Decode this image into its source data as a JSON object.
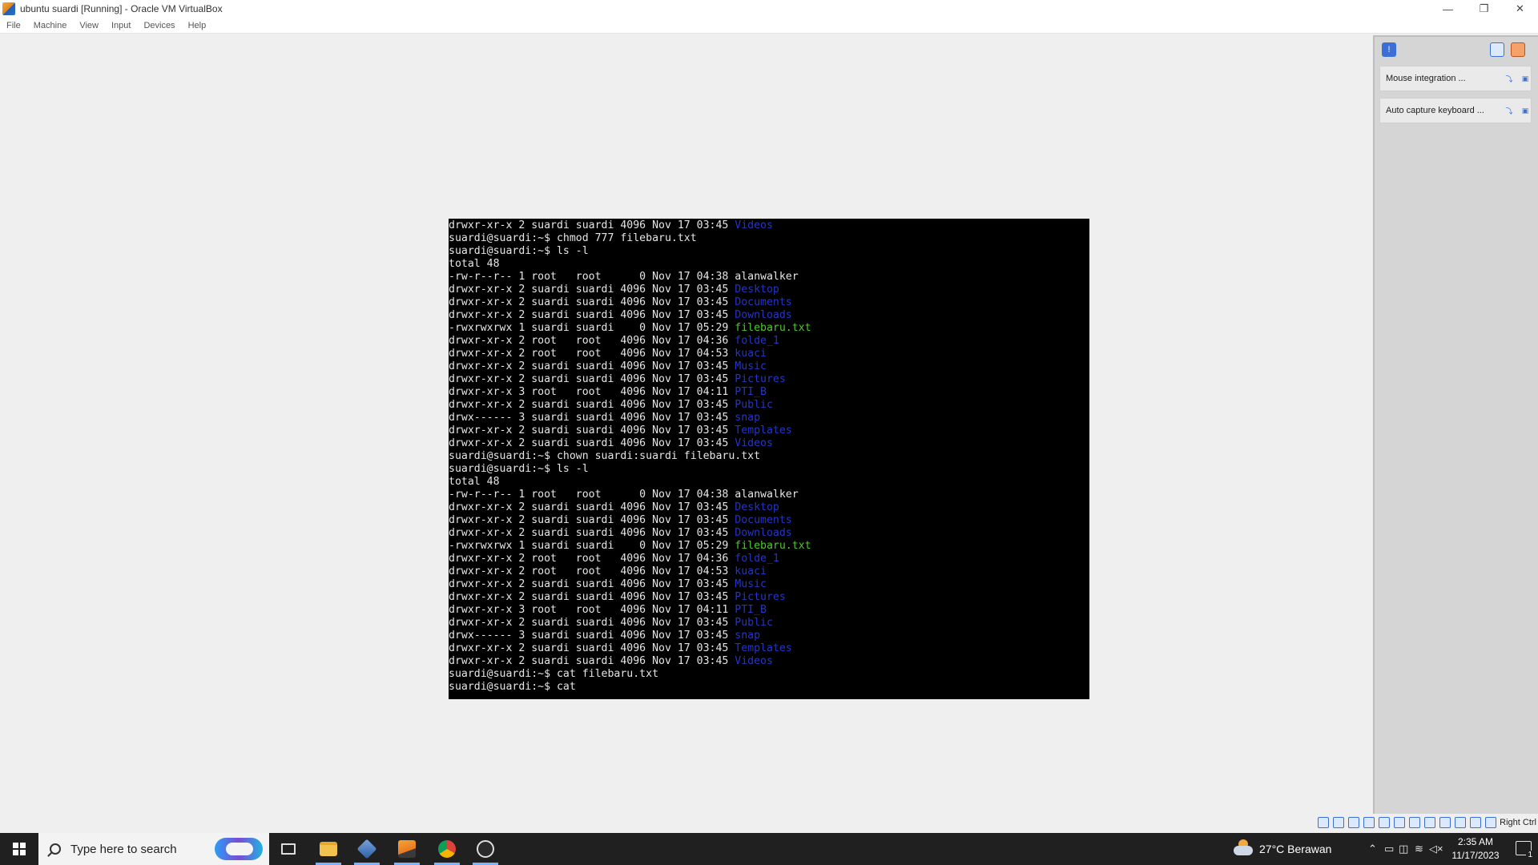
{
  "window": {
    "title": "ubuntu suardi [Running] - Oracle VM VirtualBox",
    "minimize_glyph": "—",
    "restore_glyph": "❐",
    "close_glyph": "✕"
  },
  "menu": [
    "File",
    "Machine",
    "View",
    "Input",
    "Devices",
    "Help"
  ],
  "terminal": {
    "lines": [
      [
        {
          "t": "drwxr-xr-x 2 suardi suardi 4096 Nov 17 03:45 "
        },
        {
          "t": "Videos",
          "c": "blue"
        }
      ],
      [
        {
          "t": "suardi@suardi:~$ chmod 777 filebaru.txt"
        }
      ],
      [
        {
          "t": "suardi@suardi:~$ ls -l"
        }
      ],
      [
        {
          "t": "total 48"
        }
      ],
      [
        {
          "t": "-rw-r--r-- 1 root   root      0 Nov 17 04:38 alanwalker"
        }
      ],
      [
        {
          "t": "drwxr-xr-x 2 suardi suardi 4096 Nov 17 03:45 "
        },
        {
          "t": "Desktop",
          "c": "blue"
        }
      ],
      [
        {
          "t": "drwxr-xr-x 2 suardi suardi 4096 Nov 17 03:45 "
        },
        {
          "t": "Documents",
          "c": "blue"
        }
      ],
      [
        {
          "t": "drwxr-xr-x 2 suardi suardi 4096 Nov 17 03:45 "
        },
        {
          "t": "Downloads",
          "c": "blue"
        }
      ],
      [
        {
          "t": "-rwxrwxrwx 1 suardi suardi    0 Nov 17 05:29 "
        },
        {
          "t": "filebaru.txt",
          "c": "green"
        }
      ],
      [
        {
          "t": "drwxr-xr-x 2 root   root   4096 Nov 17 04:36 "
        },
        {
          "t": "folde_1",
          "c": "blue"
        }
      ],
      [
        {
          "t": "drwxr-xr-x 2 root   root   4096 Nov 17 04:53 "
        },
        {
          "t": "kuaci",
          "c": "blue"
        }
      ],
      [
        {
          "t": "drwxr-xr-x 2 suardi suardi 4096 Nov 17 03:45 "
        },
        {
          "t": "Music",
          "c": "blue"
        }
      ],
      [
        {
          "t": "drwxr-xr-x 2 suardi suardi 4096 Nov 17 03:45 "
        },
        {
          "t": "Pictures",
          "c": "blue"
        }
      ],
      [
        {
          "t": "drwxr-xr-x 3 root   root   4096 Nov 17 04:11 "
        },
        {
          "t": "PTI_B",
          "c": "blue"
        }
      ],
      [
        {
          "t": "drwxr-xr-x 2 suardi suardi 4096 Nov 17 03:45 "
        },
        {
          "t": "Public",
          "c": "blue"
        }
      ],
      [
        {
          "t": "drwx------ 3 suardi suardi 4096 Nov 17 03:45 "
        },
        {
          "t": "snap",
          "c": "blue"
        }
      ],
      [
        {
          "t": "drwxr-xr-x 2 suardi suardi 4096 Nov 17 03:45 "
        },
        {
          "t": "Templates",
          "c": "blue"
        }
      ],
      [
        {
          "t": "drwxr-xr-x 2 suardi suardi 4096 Nov 17 03:45 "
        },
        {
          "t": "Videos",
          "c": "blue"
        }
      ],
      [
        {
          "t": "suardi@suardi:~$ chown suardi:suardi filebaru.txt"
        }
      ],
      [
        {
          "t": "suardi@suardi:~$ ls -l"
        }
      ],
      [
        {
          "t": "total 48"
        }
      ],
      [
        {
          "t": "-rw-r--r-- 1 root   root      0 Nov 17 04:38 alanwalker"
        }
      ],
      [
        {
          "t": "drwxr-xr-x 2 suardi suardi 4096 Nov 17 03:45 "
        },
        {
          "t": "Desktop",
          "c": "blue"
        }
      ],
      [
        {
          "t": "drwxr-xr-x 2 suardi suardi 4096 Nov 17 03:45 "
        },
        {
          "t": "Documents",
          "c": "blue"
        }
      ],
      [
        {
          "t": "drwxr-xr-x 2 suardi suardi 4096 Nov 17 03:45 "
        },
        {
          "t": "Downloads",
          "c": "blue"
        }
      ],
      [
        {
          "t": "-rwxrwxrwx 1 suardi suardi    0 Nov 17 05:29 "
        },
        {
          "t": "filebaru.txt",
          "c": "green"
        }
      ],
      [
        {
          "t": "drwxr-xr-x 2 root   root   4096 Nov 17 04:36 "
        },
        {
          "t": "folde_1",
          "c": "blue"
        }
      ],
      [
        {
          "t": "drwxr-xr-x 2 root   root   4096 Nov 17 04:53 "
        },
        {
          "t": "kuaci",
          "c": "blue"
        }
      ],
      [
        {
          "t": "drwxr-xr-x 2 suardi suardi 4096 Nov 17 03:45 "
        },
        {
          "t": "Music",
          "c": "blue"
        }
      ],
      [
        {
          "t": "drwxr-xr-x 2 suardi suardi 4096 Nov 17 03:45 "
        },
        {
          "t": "Pictures",
          "c": "blue"
        }
      ],
      [
        {
          "t": "drwxr-xr-x 3 root   root   4096 Nov 17 04:11 "
        },
        {
          "t": "PTI_B",
          "c": "blue"
        }
      ],
      [
        {
          "t": "drwxr-xr-x 2 suardi suardi 4096 Nov 17 03:45 "
        },
        {
          "t": "Public",
          "c": "blue"
        }
      ],
      [
        {
          "t": "drwx------ 3 suardi suardi 4096 Nov 17 03:45 "
        },
        {
          "t": "snap",
          "c": "blue"
        }
      ],
      [
        {
          "t": "drwxr-xr-x 2 suardi suardi 4096 Nov 17 03:45 "
        },
        {
          "t": "Templates",
          "c": "blue"
        }
      ],
      [
        {
          "t": "drwxr-xr-x 2 suardi suardi 4096 Nov 17 03:45 "
        },
        {
          "t": "Videos",
          "c": "blue"
        }
      ],
      [
        {
          "t": "suardi@suardi:~$ cat filebaru.txt"
        }
      ],
      [
        {
          "t": "suardi@suardi:~$ cat"
        }
      ]
    ],
    "colors": {
      "text": "#e6e6e6",
      "blue": "#2535c8",
      "green": "#4ec92a",
      "background": "#000000"
    }
  },
  "side_panel": {
    "notifications": [
      {
        "text": "Mouse integration ..."
      },
      {
        "text": "Auto capture keyboard ..."
      }
    ]
  },
  "statusbar": {
    "host_key": "Right Ctrl",
    "icons": [
      "hard-disk-icon",
      "optical-drive-icon",
      "audio-icon",
      "network-icon",
      "usb-icon",
      "shared-folders-icon",
      "display-icon",
      "video-capture-icon",
      "cpu-icon",
      "guest-additions-icon",
      "mouse-integration-icon",
      "keyboard-icon"
    ]
  },
  "taskbar": {
    "search_placeholder": "Type here to search",
    "apps": [
      "task-view-icon",
      "file-explorer-icon",
      "virtualbox-icon",
      "sublime-icon",
      "chrome-icon",
      "obs-icon"
    ],
    "weather": "27°C  Berawan",
    "time": "2:35 AM",
    "date": "11/17/2023",
    "notification_count": "1"
  }
}
